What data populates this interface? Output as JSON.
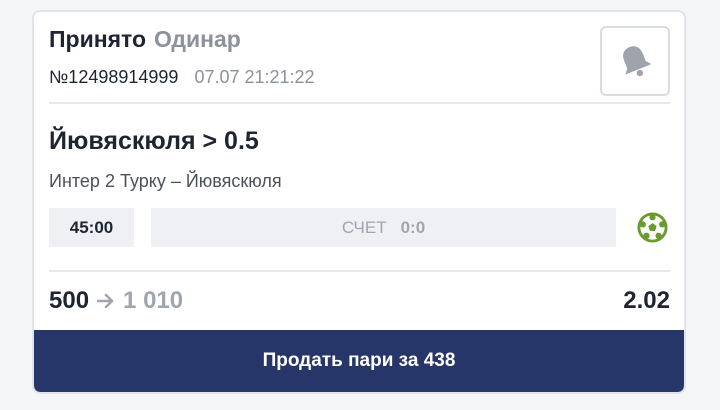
{
  "bet": {
    "status": "Принято",
    "type": "Одинар",
    "number": "№12498914999",
    "datetime": "07.07 21:21:22"
  },
  "selection": "Йювяскюля > 0.5",
  "event": "Интер 2 Турку – Йювяскюля",
  "match": {
    "time": "45:00",
    "score_label": "СЧЕТ",
    "score": "0:0"
  },
  "amounts": {
    "stake": "500",
    "payout": "1 010",
    "odds": "2.02"
  },
  "sell_button": "Продать пари за 438",
  "icons": {
    "bell": "bell-icon",
    "sport": "soccer-ball-icon",
    "arrow": "arrow-right-icon"
  },
  "colors": {
    "primary_dark": "#263668",
    "text_dark": "#1f2433",
    "text_muted": "#8c919b",
    "soccer_green": "#6b9a2f"
  }
}
